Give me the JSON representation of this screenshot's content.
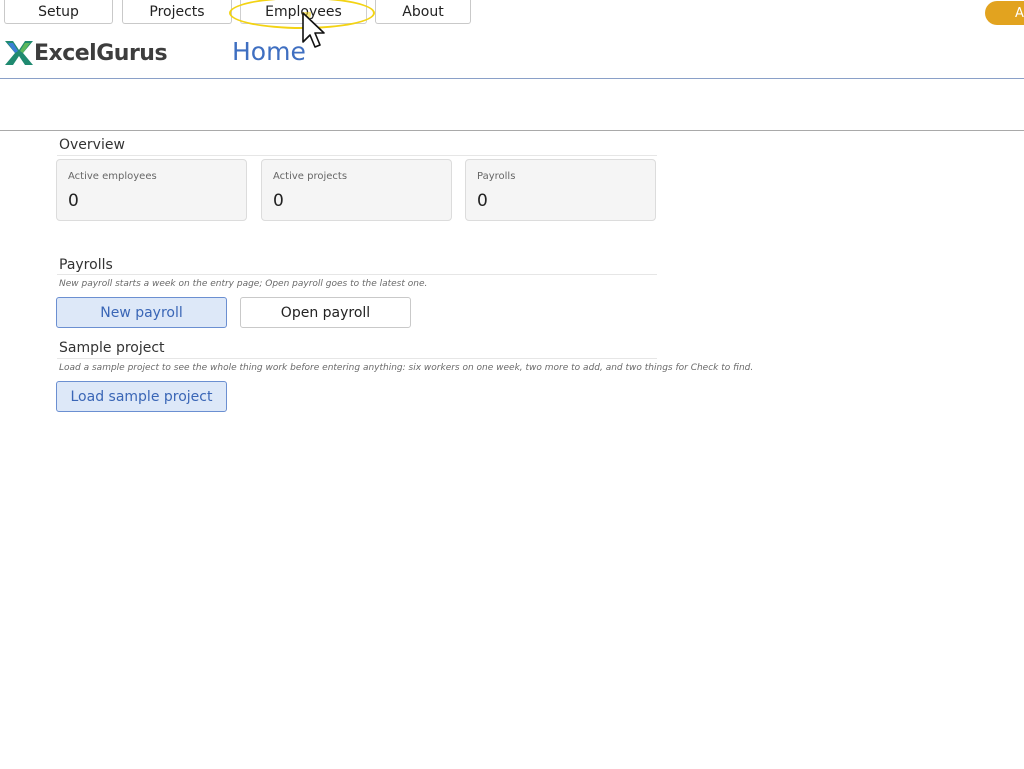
{
  "nav": {
    "tabs": [
      {
        "label": "Setup"
      },
      {
        "label": "Projects"
      },
      {
        "label": "Employees"
      },
      {
        "label": "About"
      }
    ],
    "account_pill": "A"
  },
  "brand": {
    "name": "ExcelGurus"
  },
  "page": {
    "title": "Home"
  },
  "overview": {
    "title": "Overview",
    "cards": [
      {
        "label": "Active employees",
        "value": "0"
      },
      {
        "label": "Active projects",
        "value": "0"
      },
      {
        "label": "Payrolls",
        "value": "0"
      }
    ]
  },
  "payrolls": {
    "title": "Payrolls",
    "note": "New payroll starts a week on the entry page; Open payroll goes to the latest one.",
    "new_button": "New payroll",
    "open_button": "Open payroll"
  },
  "sample": {
    "title": "Sample project",
    "note": "Load a sample project to see the whole thing work before entering anything: six workers on one week, two more to add, and two things for Check to find.",
    "load_button": "Load sample project"
  },
  "colors": {
    "accent": "#3f6fc1",
    "pill": "#e2a31f",
    "highlight": "#f3d313"
  }
}
